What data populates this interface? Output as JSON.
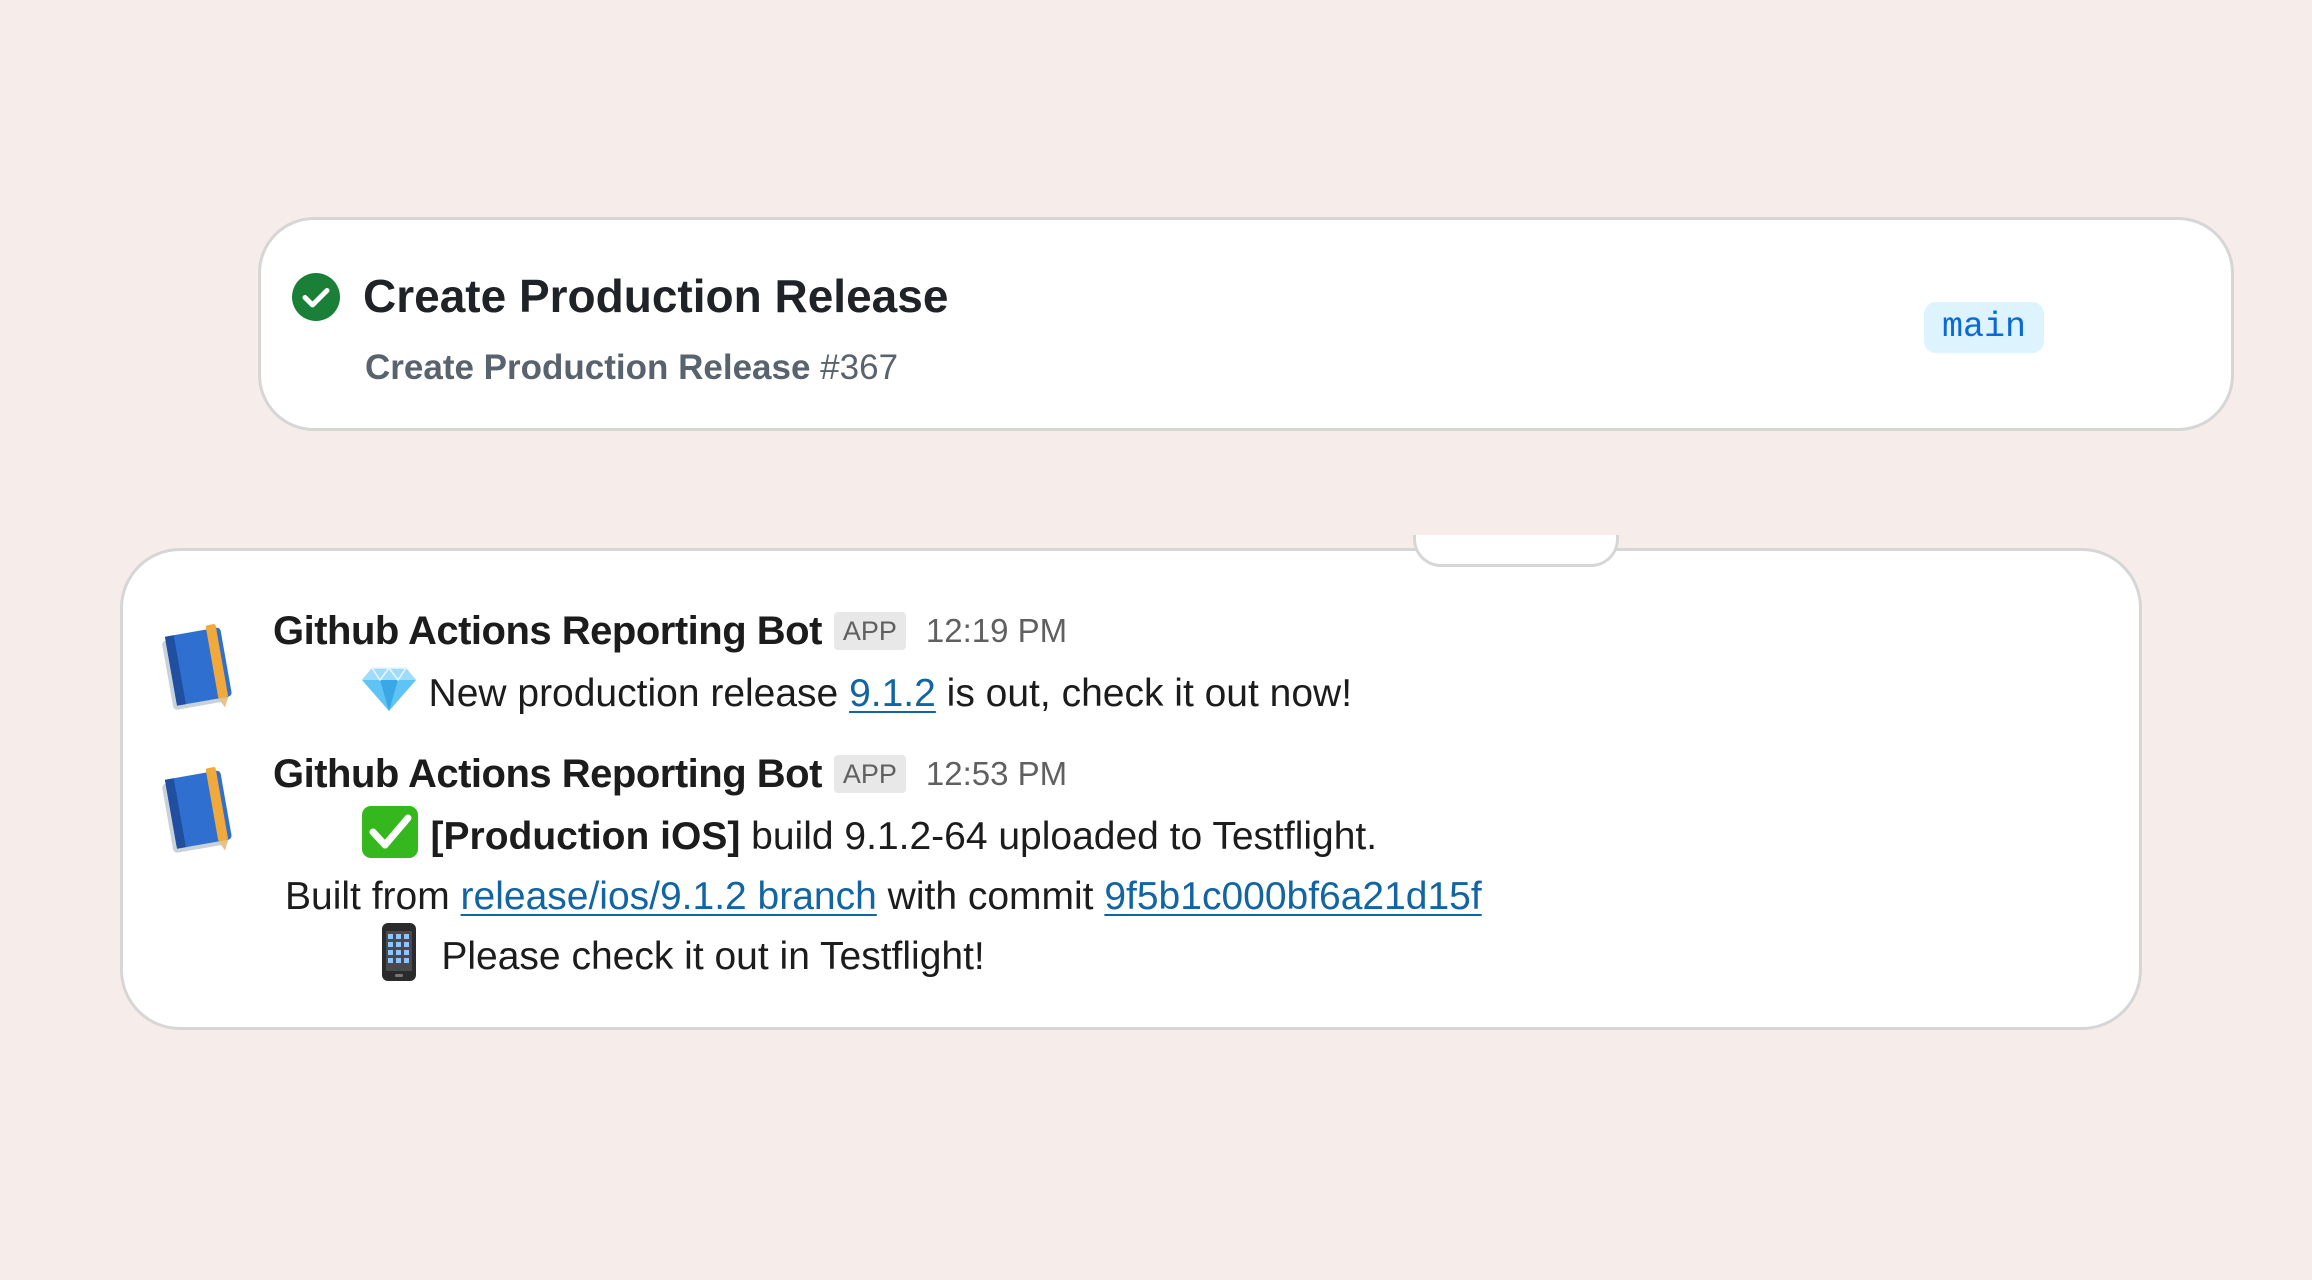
{
  "colors": {
    "page_background": "#f6ecea",
    "card_background": "#ffffff",
    "card_border": "#d6d6d6",
    "success_green": "#1a7f37",
    "link_blue": "#1264a3",
    "branch_badge_bg": "#ddf4ff",
    "branch_badge_text": "#0969da"
  },
  "workflow": {
    "status_icon": "check-circle-icon",
    "title": "Create Production Release",
    "run_name": "Create Production Release",
    "run_number": "#367",
    "branch": "main"
  },
  "messages": [
    {
      "avatar_icon": "notebook-pencil-icon",
      "sender": "Github Actions Reporting Bot",
      "badge": "APP",
      "time": "12:19 PM",
      "emoji_icon": "gem-icon",
      "text_before": " New production release ",
      "link_text": "9.1.2",
      "text_after": " is out, check it out now!"
    },
    {
      "avatar_icon": "notebook-pencil-icon",
      "sender": "Github Actions Reporting Bot",
      "badge": "APP",
      "time": "12:53 PM",
      "line1": {
        "emoji_icon": "check-mark-button-icon",
        "bold_text": " [Production iOS]",
        "text": " build 9.1.2-64 uploaded to Testflight."
      },
      "line2": {
        "prefix": "Built from ",
        "branch_link": "release/ios/9.1.2 branch",
        "middle": " with commit ",
        "commit_link": "9f5b1c000bf6a21d15f"
      },
      "line3": {
        "emoji_icon": "mobile-phone-icon",
        "text": "  Please check it out in Testflight!"
      }
    }
  ]
}
